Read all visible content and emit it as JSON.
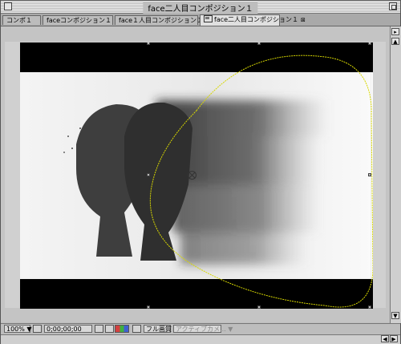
{
  "window": {
    "title": "face二人目コンポジション１"
  },
  "tabs": [
    {
      "label": "コンポ１",
      "active": false
    },
    {
      "label": "faceコンポジション１",
      "active": false
    },
    {
      "label": "face１人目コンポジション１",
      "active": false
    },
    {
      "label": "face二人目コンポジション１",
      "active": true
    }
  ],
  "statusbar": {
    "zoom": "100%",
    "timecode": "0;00;00;00",
    "resolution": "フル画質",
    "camera": "アクティブカメ..."
  },
  "colors": {
    "motion_path": "#d8d800",
    "guide_lines": "#e6e6e6",
    "channel_red": "#d44040",
    "channel_green": "#40b040",
    "channel_blue": "#4060d0"
  },
  "icons": [
    "close-icon",
    "zoom-icon",
    "composition-icon",
    "grid-icon",
    "camera-icon",
    "person-icon",
    "rgb-channels-icon",
    "region-icon",
    "chevron-down-icon"
  ]
}
